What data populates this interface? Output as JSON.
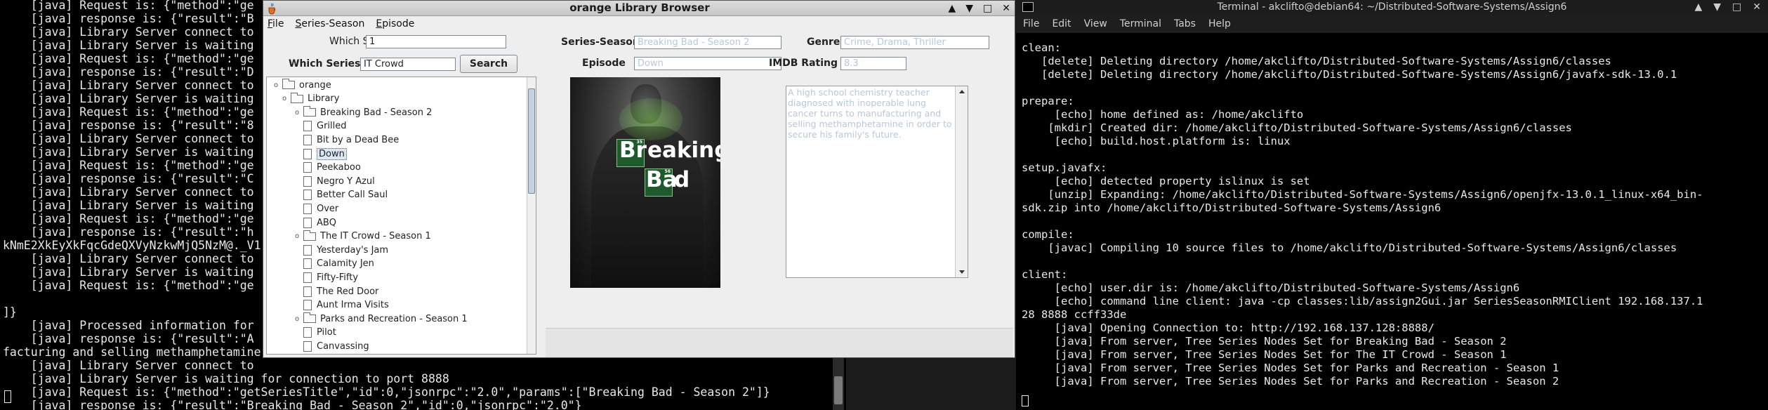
{
  "left_terminal": {
    "lines": [
      "    [java] Request is: {\"method\":\"ge",
      "    [java] response is: {\"result\":\"B",
      "    [java] Library Server connect to",
      "    [java] Library Server is waiting",
      "    [java] Request is: {\"method\":\"ge",
      "    [java] response is: {\"result\":\"D",
      "    [java] Library Server connect to",
      "    [java] Library Server is waiting",
      "    [java] Request is: {\"method\":\"ge",
      "    [java] response is: {\"result\":\"8",
      "    [java] Library Server connect to",
      "    [java] Library Server is waiting",
      "    [java] Request is: {\"method\":\"ge",
      "    [java] response is: {\"result\":\"C",
      "    [java] Library Server connect to",
      "    [java] Library Server is waiting",
      "    [java] Request is: {\"method\":\"ge",
      "    [java] response is: {\"result\":\"h",
      "kNmE2XkEyXkFqcGdeQXVyNzkwMjQ5NzM@._V1",
      "    [java] Library Server connect to",
      "    [java] Library Server is waiting",
      "    [java] Request is: {\"method\":\"ge",
      "",
      "]}",
      "    [java] Processed information for",
      "    [java] response is: {\"result\":\"A",
      "facturing and selling methamphetamine",
      "    [java] Library Server connect to",
      "    [java] Library Server is waiting for connection to port 8888",
      "    [java] Request is: {\"method\":\"getSeriesTitle\",\"id\":0,\"jsonrpc\":\"2.0\",\"params\":[\"Breaking Bad - Season 2\"]}",
      "    [java] response is: {\"result\":\"Breaking Bad - Season 2\",\"id\":0,\"jsonrpc\":\"2.0\"}"
    ]
  },
  "browser": {
    "title": "orange Library Browser",
    "window_buttons": [
      "▲",
      "▼",
      "□",
      "✕"
    ],
    "menu": [
      "File",
      "Series-Season",
      "Episode"
    ],
    "which_season_label": "Which Season?",
    "which_season_value": "1",
    "which_series_label": "Which Series?",
    "which_series_value": "IT Crowd",
    "search_label": "Search",
    "tree": [
      {
        "label": "orange",
        "level": 0,
        "kind": "folder",
        "toggle": "⌄"
      },
      {
        "label": "Library",
        "level": 1,
        "kind": "folder",
        "toggle": "⌄"
      },
      {
        "label": "Breaking Bad - Season 2",
        "level": 2,
        "kind": "folder",
        "toggle": "⌄"
      },
      {
        "label": "Grilled",
        "level": 3,
        "kind": "leaf"
      },
      {
        "label": "Bit by a Dead Bee",
        "level": 3,
        "kind": "leaf"
      },
      {
        "label": "Down",
        "level": 3,
        "kind": "leaf",
        "selected": true
      },
      {
        "label": "Peekaboo",
        "level": 3,
        "kind": "leaf"
      },
      {
        "label": "Negro Y Azul",
        "level": 3,
        "kind": "leaf"
      },
      {
        "label": "Better Call Saul",
        "level": 3,
        "kind": "leaf"
      },
      {
        "label": "Over",
        "level": 3,
        "kind": "leaf"
      },
      {
        "label": "ABQ",
        "level": 3,
        "kind": "leaf"
      },
      {
        "label": "The IT Crowd - Season 1",
        "level": 2,
        "kind": "folder",
        "toggle": "⌄"
      },
      {
        "label": "Yesterday's Jam",
        "level": 3,
        "kind": "leaf"
      },
      {
        "label": "Calamity Jen",
        "level": 3,
        "kind": "leaf"
      },
      {
        "label": "Fifty-Fifty",
        "level": 3,
        "kind": "leaf"
      },
      {
        "label": "The Red Door",
        "level": 3,
        "kind": "leaf"
      },
      {
        "label": "Aunt Irma Visits",
        "level": 3,
        "kind": "leaf"
      },
      {
        "label": "Parks and Recreation - Season 1",
        "level": 2,
        "kind": "folder",
        "toggle": "⌄"
      },
      {
        "label": "Pilot",
        "level": 3,
        "kind": "leaf"
      },
      {
        "label": "Canvassing",
        "level": 3,
        "kind": "leaf"
      }
    ],
    "series_season_label": "Series-Season",
    "series_season_value": "Breaking Bad - Season 2",
    "genre_label": "Genre",
    "genre_value": "Crime, Drama, Thriller",
    "episode_label": "Episode",
    "episode_value": "Down",
    "imdb_label": "IMDB Rating",
    "imdb_value": "8.3",
    "poster_text": [
      "Br",
      "eaking",
      "Ba",
      "d"
    ],
    "poster_tile_numbers": [
      "35",
      "56"
    ],
    "description": "A high school chemistry teacher diagnosed with inoperable lung cancer turns to manufacturing and selling methamphetamine in order to secure his family's future."
  },
  "right_terminal": {
    "title": "Terminal - akclifto@debian64: ~/Distributed-Software-Systems/Assign6",
    "window_buttons": [
      "▲",
      "▼",
      "□",
      "✕"
    ],
    "menu": [
      "File",
      "Edit",
      "View",
      "Terminal",
      "Tabs",
      "Help"
    ],
    "lines": [
      "clean:",
      "   [delete] Deleting directory /home/akclifto/Distributed-Software-Systems/Assign6/classes",
      "   [delete] Deleting directory /home/akclifto/Distributed-Software-Systems/Assign6/javafx-sdk-13.0.1",
      "",
      "prepare:",
      "     [echo] home defined as: /home/akclifto",
      "    [mkdir] Created dir: /home/akclifto/Distributed-Software-Systems/Assign6/classes",
      "     [echo] build.host.platform is: linux",
      "",
      "setup.javafx:",
      "     [echo] detected property islinux is set",
      "    [unzip] Expanding: /home/akclifto/Distributed-Software-Systems/Assign6/openjfx-13.0.1_linux-x64_bin-",
      "sdk.zip into /home/akclifto/Distributed-Software-Systems/Assign6",
      "",
      "compile:",
      "    [javac] Compiling 10 source files to /home/akclifto/Distributed-Software-Systems/Assign6/classes",
      "",
      "client:",
      "     [echo] user.dir is: /home/akclifto/Distributed-Software-Systems/Assign6",
      "     [echo] command line client: java -cp classes:lib/assign2Gui.jar SeriesSeasonRMIClient 192.168.137.1",
      "28 8888 ccff33de",
      "     [java] Opening Connection to: http://192.168.137.128:8888/",
      "     [java] From server, Tree Series Nodes Set for Breaking Bad - Season 2",
      "     [java] From server, Tree Series Nodes Set for The IT Crowd - Season 1",
      "     [java] From server, Tree Series Nodes Set for Parks and Recreation - Season 1",
      "     [java] From server, Tree Series Nodes Set for Parks and Recreation - Season 2"
    ]
  }
}
